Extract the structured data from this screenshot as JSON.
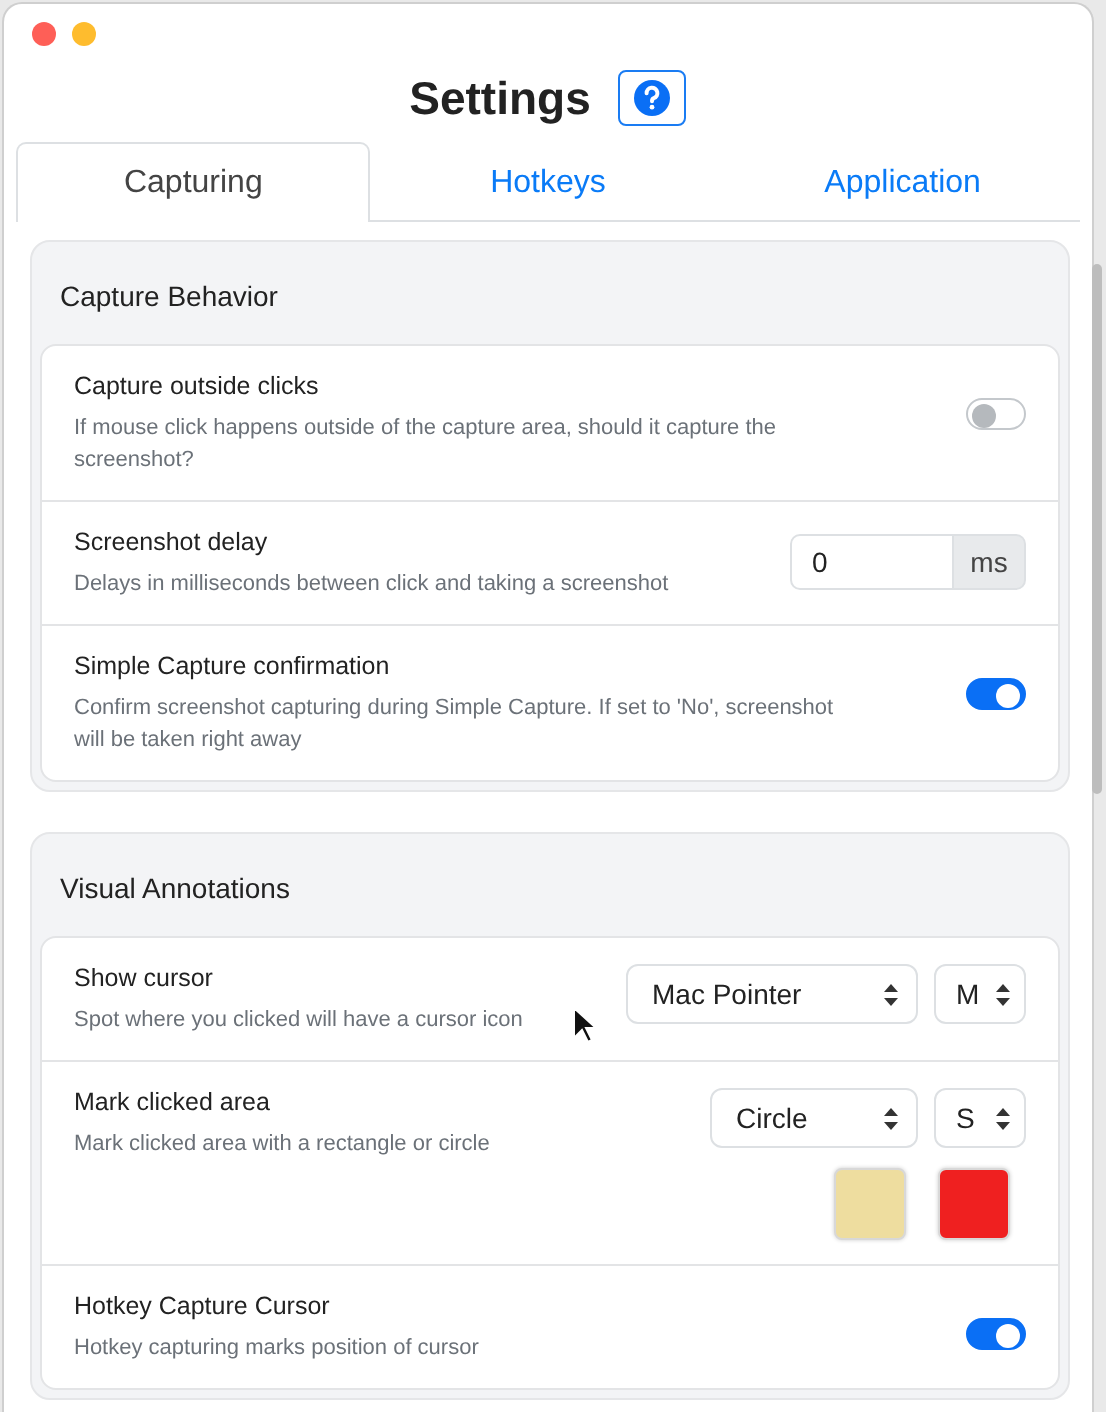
{
  "window": {
    "title": "Settings"
  },
  "tabs": [
    {
      "label": "Capturing",
      "selected": true
    },
    {
      "label": "Hotkeys",
      "selected": false
    },
    {
      "label": "Application",
      "selected": false
    }
  ],
  "sections": [
    {
      "title": "Capture Behavior",
      "rows": [
        {
          "kind": "toggle",
          "title": "Capture outside clicks",
          "description": "If mouse click happens outside of the capture area, should it capture the screenshot?",
          "on": false
        },
        {
          "kind": "number",
          "title": "Screenshot delay",
          "description": "Delays in milliseconds between click and taking a screenshot",
          "value": "0",
          "unit": "ms"
        },
        {
          "kind": "toggle",
          "title": "Simple Capture confirmation",
          "description": "Confirm screenshot capturing during Simple Capture. If set to 'No', screenshot will be taken right away",
          "on": true
        }
      ]
    },
    {
      "title": "Visual Annotations",
      "rows": [
        {
          "kind": "select",
          "title": "Show cursor",
          "description": "Spot where you clicked will have a cursor icon",
          "selects": [
            "Mac Pointer",
            "M"
          ]
        },
        {
          "kind": "select",
          "title": "Mark clicked area",
          "description": "Mark clicked area with a rectangle or circle",
          "selects": [
            "Circle",
            "S"
          ],
          "swatches": [
            {
              "color": "#eedd9f"
            },
            {
              "color": "#ef2020"
            }
          ]
        },
        {
          "kind": "toggle",
          "title": "Hotkey Capture Cursor",
          "description": "Hotkey capturing marks position of cursor",
          "on": true
        }
      ]
    }
  ]
}
